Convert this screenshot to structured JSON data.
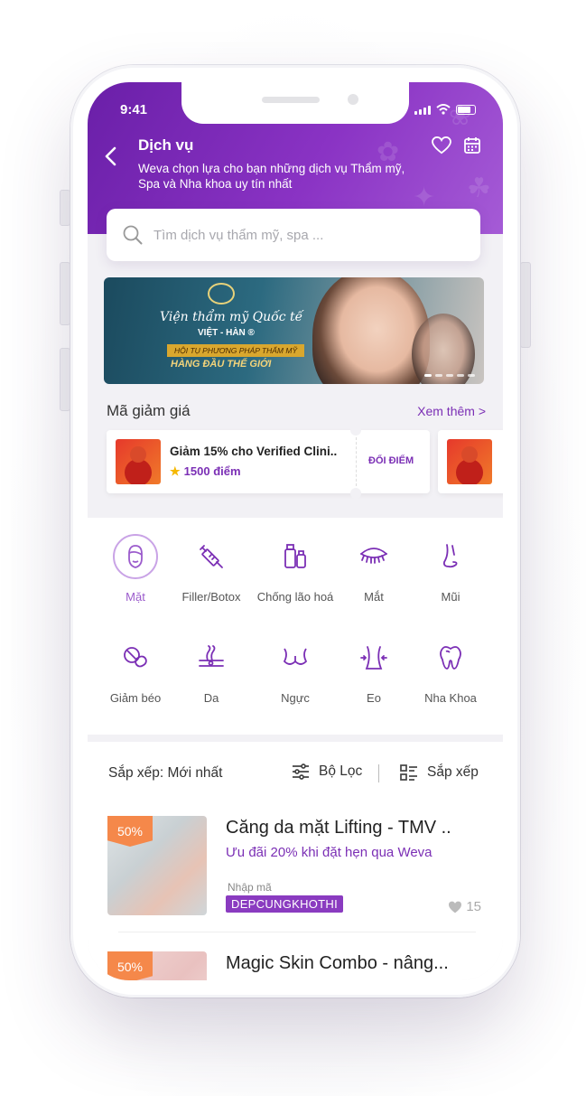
{
  "status_bar": {
    "time": "9:41"
  },
  "header": {
    "title": "Dịch vụ",
    "subtitle": "Weva chọn lựa cho bạn những dịch vụ Thẩm mỹ, Spa và Nha khoa uy tín nhất",
    "icons": [
      "chevron-left-icon",
      "heart-icon",
      "calendar-icon"
    ]
  },
  "search": {
    "placeholder": "Tìm dịch vụ thẩm mỹ, spa ..."
  },
  "banner": {
    "line1": "Viện thẩm mỹ Quốc tế",
    "line2": "VIỆT - HÀN ®",
    "line3": "HỘI TỤ PHƯƠNG PHÁP THẨM MỸ",
    "line4": "HÀNG ĐẦU THẾ GIỚI",
    "slide_count": 5,
    "active_slide": 1
  },
  "coupons": {
    "title": "Mã giảm giá",
    "more": "Xem thêm >",
    "items": [
      {
        "title": "Giảm 15% cho Verified Clini..",
        "points": "1500 điểm",
        "action": "ĐỔI ĐIỂM"
      }
    ]
  },
  "categories": [
    {
      "label": "Mặt",
      "icon": "face-icon",
      "selected": true
    },
    {
      "label": "Filler/Botox",
      "icon": "syringe-icon",
      "selected": false
    },
    {
      "label": "Chống lão hoá",
      "icon": "cosmetics-icon",
      "selected": false
    },
    {
      "label": "Mắt",
      "icon": "eye-icon",
      "selected": false
    },
    {
      "label": "Mũi",
      "icon": "nose-icon",
      "selected": false
    },
    {
      "label": "Giảm béo",
      "icon": "pill-icon",
      "selected": false
    },
    {
      "label": "Da",
      "icon": "skin-icon",
      "selected": false
    },
    {
      "label": "Ngực",
      "icon": "bra-icon",
      "selected": false
    },
    {
      "label": "Eo",
      "icon": "waist-icon",
      "selected": false
    },
    {
      "label": "Nha Khoa",
      "icon": "tooth-icon",
      "selected": false
    }
  ],
  "sort": {
    "label": "Sắp xếp: Mới nhất",
    "filter": "Bộ Lọc",
    "sort_button": "Sắp xếp"
  },
  "services": [
    {
      "badge": "50%",
      "name": "Căng da mặt Lifting - TMV ..",
      "promo": "Ưu đãi 20% khi đặt hẹn qua Weva",
      "code_label": "Nhập mã",
      "code": "DEPCUNGKHOTHI",
      "likes": "15"
    },
    {
      "badge": "50%",
      "name": "Magic Skin Combo - nâng..."
    }
  ],
  "colors": {
    "primary": "#7b2fb5",
    "header_start": "#6a1fa8",
    "header_end": "#a55bd6",
    "badge": "#f5884a"
  }
}
